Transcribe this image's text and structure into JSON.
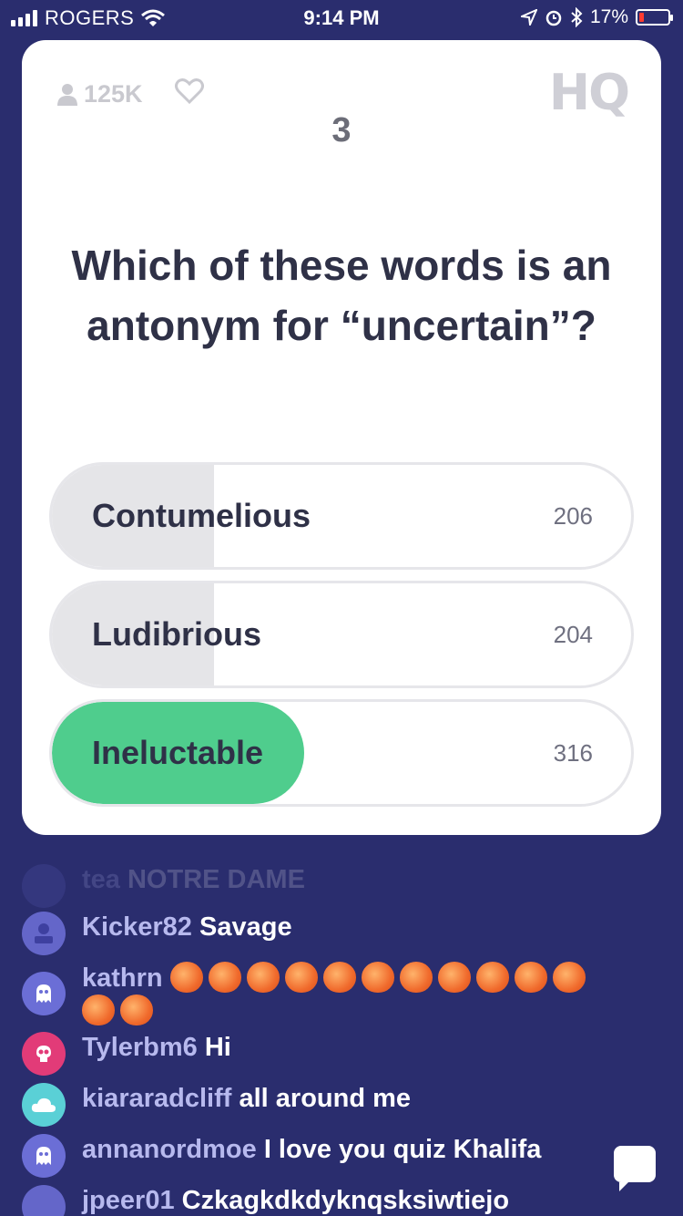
{
  "status_bar": {
    "carrier": "ROGERS",
    "time": "9:14 PM",
    "battery": "17%"
  },
  "game": {
    "viewers": "125K",
    "logo": "HQ",
    "question_number": "3",
    "question": "Which of these words is an antonym for “uncertain”?",
    "answers": [
      {
        "label": "Contumelious",
        "count": "206",
        "fill_fraction": 0.28,
        "correct": false
      },
      {
        "label": "Ludibrious",
        "count": "204",
        "fill_fraction": 0.28,
        "correct": false
      },
      {
        "label": "Ineluctable",
        "count": "316",
        "fill_fraction": 0.435,
        "correct": true
      }
    ]
  },
  "chat": {
    "messages": [
      {
        "user": "tea",
        "text": "NOTRE DAME",
        "avatar_color": "#6466c9"
      },
      {
        "user": "Kicker82",
        "text": "Savage",
        "avatar_color": "#6466c9"
      },
      {
        "user": "kathrn",
        "text": "",
        "peaches": 13,
        "avatar_color": "#6b6ed6"
      },
      {
        "user": "Tylerbm6",
        "text": "Hi",
        "avatar_color": "#e23b78"
      },
      {
        "user": "kiararadcliff",
        "text": "all around me",
        "avatar_color": "#5ad0d6"
      },
      {
        "user": "annanordmoe",
        "text": "I love you quiz Khalifa",
        "avatar_color": "#6b6ed6"
      },
      {
        "user": "jpeer01",
        "text": "Czkagkdkdyknqsksiwtiejo",
        "avatar_color": "#6466c9"
      }
    ]
  },
  "icons": {
    "status": [
      "signal-icon",
      "wifi-icon",
      "location-icon",
      "alarm-icon",
      "bluetooth-icon",
      "battery-icon"
    ],
    "card": [
      "user-icon",
      "heart-icon"
    ],
    "chat": [
      "chat-bubble-icon"
    ]
  }
}
